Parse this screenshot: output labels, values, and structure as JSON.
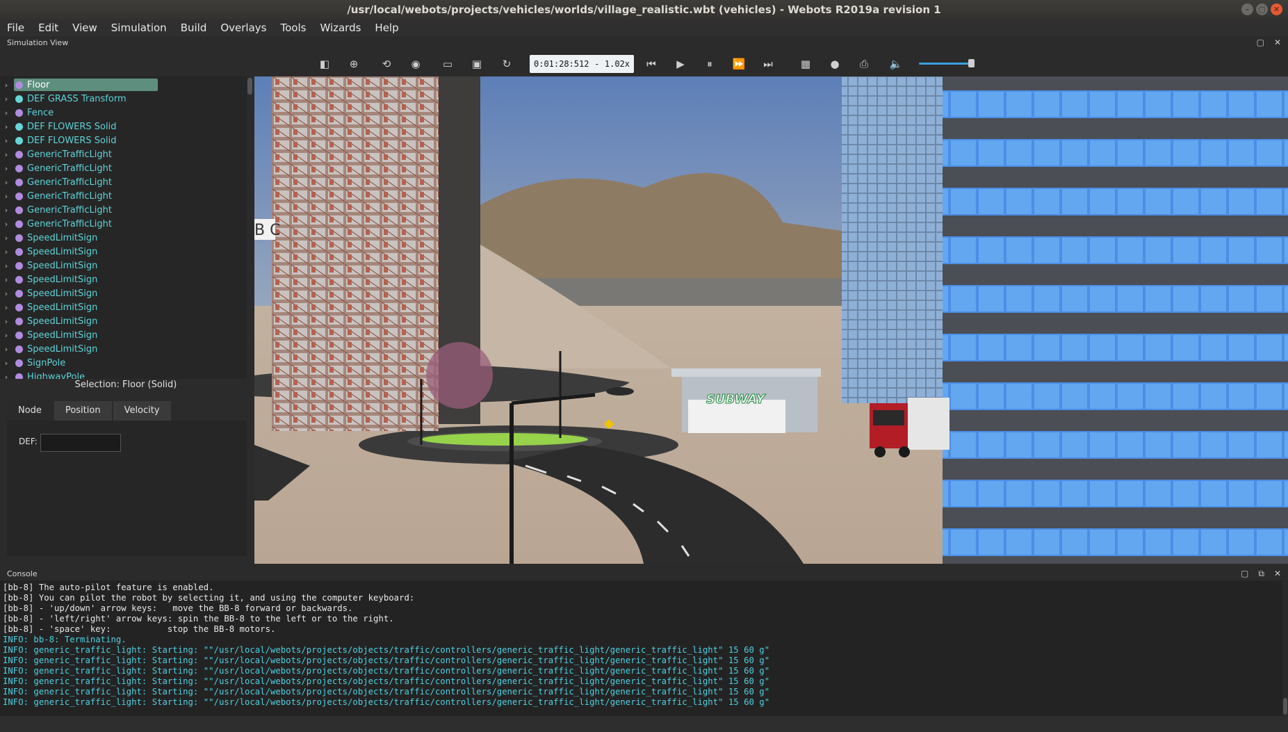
{
  "window": {
    "title": "/usr/local/webots/projects/vehicles/worlds/village_realistic.wbt (vehicles) - Webots R2019a revision 1",
    "buttons": [
      "–",
      "▢",
      "✕"
    ]
  },
  "menu": [
    "File",
    "Edit",
    "View",
    "Simulation",
    "Build",
    "Overlays",
    "Tools",
    "Wizards",
    "Help"
  ],
  "simulation_view": {
    "label": "Simulation View",
    "time": "0:01:28:512",
    "separator": "-",
    "speed": "1.02x",
    "volume_level": 0.9
  },
  "toolbar_icons": [
    "toggle-scene-tree-icon",
    "add-node-icon",
    "reload-icon",
    "view-icon",
    "open-world-icon",
    "save-world-icon",
    "revert-icon",
    "step-back-icon",
    "play-icon",
    "pause-icon",
    "fast-icon",
    "fastest-icon",
    "record-movie-icon",
    "record-animation-icon",
    "screenshot-icon",
    "volume-icon"
  ],
  "scene_tree": {
    "items": [
      {
        "label": "Floor",
        "color": "#b18be0",
        "selected": true
      },
      {
        "label": "DEF GRASS Transform",
        "color": "#67d6d8"
      },
      {
        "label": "Fence",
        "color": "#b18be0"
      },
      {
        "label": "DEF FLOWERS Solid",
        "color": "#67d6d8"
      },
      {
        "label": "DEF FLOWERS Solid",
        "color": "#67d6d8"
      },
      {
        "label": "GenericTrafficLight",
        "color": "#b18be0"
      },
      {
        "label": "GenericTrafficLight",
        "color": "#b18be0"
      },
      {
        "label": "GenericTrafficLight",
        "color": "#b18be0"
      },
      {
        "label": "GenericTrafficLight",
        "color": "#b18be0"
      },
      {
        "label": "GenericTrafficLight",
        "color": "#b18be0"
      },
      {
        "label": "GenericTrafficLight",
        "color": "#b18be0"
      },
      {
        "label": "SpeedLimitSign",
        "color": "#b18be0"
      },
      {
        "label": "SpeedLimitSign",
        "color": "#b18be0"
      },
      {
        "label": "SpeedLimitSign",
        "color": "#b18be0"
      },
      {
        "label": "SpeedLimitSign",
        "color": "#b18be0"
      },
      {
        "label": "SpeedLimitSign",
        "color": "#b18be0"
      },
      {
        "label": "SpeedLimitSign",
        "color": "#b18be0"
      },
      {
        "label": "SpeedLimitSign",
        "color": "#b18be0"
      },
      {
        "label": "SpeedLimitSign",
        "color": "#b18be0"
      },
      {
        "label": "SpeedLimitSign",
        "color": "#b18be0"
      },
      {
        "label": "SignPole",
        "color": "#b18be0"
      },
      {
        "label": "HighwayPole",
        "color": "#b18be0"
      }
    ]
  },
  "selection": {
    "label": "Selection: Floor (Solid)"
  },
  "field_tabs": [
    "Node",
    "Position",
    "Velocity"
  ],
  "def_field": {
    "label": "DEF:",
    "value": ""
  },
  "viewport": {
    "billboard_text": "B C",
    "restaurant_sign": "SUBWAY"
  },
  "console": {
    "label": "Console",
    "lines": [
      {
        "text": "[bb-8] The auto-pilot feature is enabled.",
        "type": "normal"
      },
      {
        "text": "[bb-8] You can pilot the robot by selecting it, and using the computer keyboard:",
        "type": "normal"
      },
      {
        "text": "[bb-8] - 'up/down' arrow keys:   move the BB-8 forward or backwards.",
        "type": "normal"
      },
      {
        "text": "[bb-8] - 'left/right' arrow keys: spin the BB-8 to the left or to the right.",
        "type": "normal"
      },
      {
        "text": "[bb-8] - 'space' key:           stop the BB-8 motors.",
        "type": "normal"
      },
      {
        "text": "INFO: bb-8: Terminating.",
        "type": "info"
      },
      {
        "text": "INFO: generic_traffic_light: Starting: \"\"/usr/local/webots/projects/objects/traffic/controllers/generic_traffic_light/generic_traffic_light\" 15 60 g\"",
        "type": "info"
      },
      {
        "text": "INFO: generic_traffic_light: Starting: \"\"/usr/local/webots/projects/objects/traffic/controllers/generic_traffic_light/generic_traffic_light\" 15 60 g\"",
        "type": "info"
      },
      {
        "text": "INFO: generic_traffic_light: Starting: \"\"/usr/local/webots/projects/objects/traffic/controllers/generic_traffic_light/generic_traffic_light\" 15 60 g\"",
        "type": "info"
      },
      {
        "text": "INFO: generic_traffic_light: Starting: \"\"/usr/local/webots/projects/objects/traffic/controllers/generic_traffic_light/generic_traffic_light\" 15 60 g\"",
        "type": "info"
      },
      {
        "text": "INFO: generic_traffic_light: Starting: \"\"/usr/local/webots/projects/objects/traffic/controllers/generic_traffic_light/generic_traffic_light\" 15 60 g\"",
        "type": "info"
      },
      {
        "text": "INFO: generic_traffic_light: Starting: \"\"/usr/local/webots/projects/objects/traffic/controllers/generic_traffic_light/generic_traffic_light\" 15 60 g\"",
        "type": "info"
      }
    ]
  },
  "dock_controls": [
    "▢",
    "⧉",
    "✕"
  ]
}
